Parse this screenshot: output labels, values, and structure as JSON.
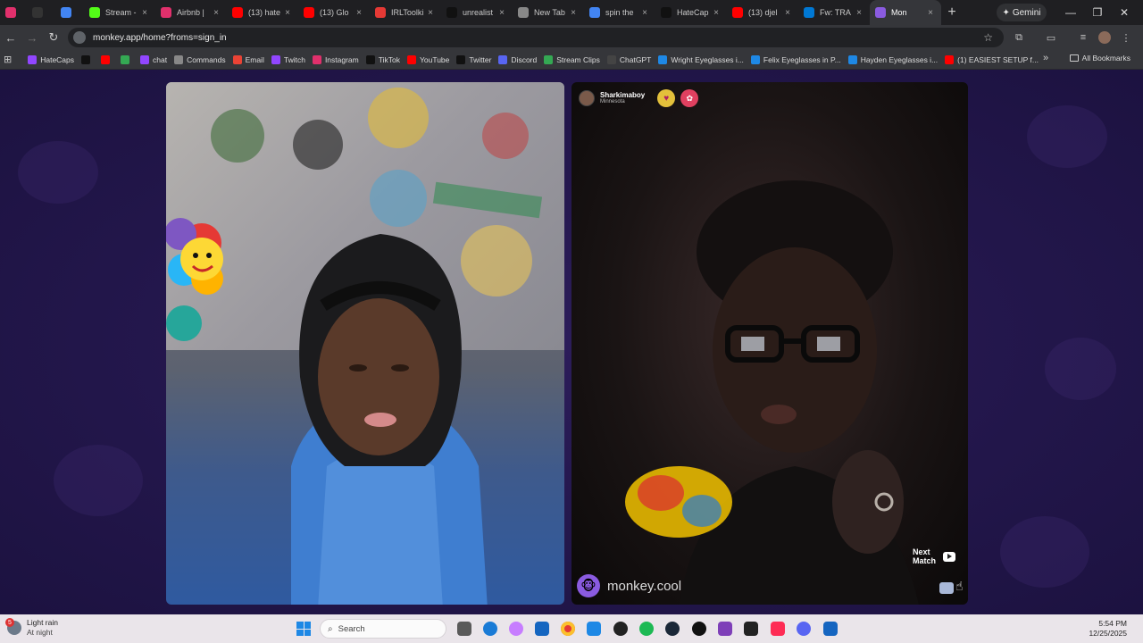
{
  "tabs": [
    {
      "title": "",
      "icon": "instagram-icon",
      "color": "#e1306c"
    },
    {
      "title": "",
      "icon": "threads-icon",
      "color": "#333333"
    },
    {
      "title": "",
      "icon": "docs-icon",
      "color": "#4285f4"
    },
    {
      "title": "Stream -",
      "icon": "kick-icon",
      "color": "#53fc18"
    },
    {
      "title": "Airbnb |",
      "icon": "instagram-icon",
      "color": "#e1306c"
    },
    {
      "title": "(13) hate",
      "icon": "youtube-icon",
      "color": "#ff0000"
    },
    {
      "title": "(13) Glo",
      "icon": "youtube-icon",
      "color": "#ff0000"
    },
    {
      "title": "IRLToolki",
      "icon": "irl-icon",
      "color": "#e53935"
    },
    {
      "title": "unrealist",
      "icon": "tiktok-icon",
      "color": "#111111"
    },
    {
      "title": "New Tab",
      "icon": "chrome-icon",
      "color": "#888888"
    },
    {
      "title": "spin the",
      "icon": "google-icon",
      "color": "#4285f4"
    },
    {
      "title": "HateCap",
      "icon": "x-icon",
      "color": "#111111"
    },
    {
      "title": "(13) djel",
      "icon": "youtube-icon",
      "color": "#ff0000"
    },
    {
      "title": "Fw: TRA",
      "icon": "outlook-icon",
      "color": "#0078d4"
    },
    {
      "title": "Mon",
      "icon": "monkey-icon",
      "color": "#8a5be0",
      "active": true
    }
  ],
  "gemini_label": "Gemini",
  "url": "monkey.app/home?froms=sign_in",
  "bookmarks": [
    {
      "label": "HateCaps",
      "icon": "twitch-icon",
      "color": "#9146ff"
    },
    {
      "label": "",
      "icon": "x-icon",
      "color": "#111111"
    },
    {
      "label": "",
      "icon": "youtube-icon",
      "color": "#ff0000"
    },
    {
      "label": "",
      "icon": "maps-icon",
      "color": "#34a853"
    },
    {
      "label": "chat",
      "icon": "twitch-icon",
      "color": "#9146ff"
    },
    {
      "label": "Commands",
      "icon": "commands-icon",
      "color": "#888888"
    },
    {
      "label": "Email",
      "icon": "gmail-icon",
      "color": "#ea4335"
    },
    {
      "label": "Twitch",
      "icon": "twitch-icon",
      "color": "#9146ff"
    },
    {
      "label": "Instagram",
      "icon": "instagram-icon",
      "color": "#e1306c"
    },
    {
      "label": "TikTok",
      "icon": "tiktok-icon",
      "color": "#111111"
    },
    {
      "label": "YouTube",
      "icon": "youtube-icon",
      "color": "#ff0000"
    },
    {
      "label": "Twitter",
      "icon": "x-icon",
      "color": "#111111"
    },
    {
      "label": "Discord",
      "icon": "discord-icon",
      "color": "#5865f2"
    },
    {
      "label": "Stream Clips",
      "icon": "drive-icon",
      "color": "#34a853"
    },
    {
      "label": "ChatGPT",
      "icon": "chatgpt-icon",
      "color": "#444444"
    },
    {
      "label": "Wright Eyeglasses i...",
      "icon": "wp-icon",
      "color": "#1e88e5"
    },
    {
      "label": "Felix Eyeglasses in P...",
      "icon": "wp-icon",
      "color": "#1e88e5"
    },
    {
      "label": "Hayden Eyeglasses i...",
      "icon": "wp-icon",
      "color": "#1e88e5"
    },
    {
      "label": "(1) EASIEST SETUP f...",
      "icon": "youtube-icon",
      "color": "#ff0000"
    }
  ],
  "all_bookmarks": "All Bookmarks",
  "remote_user": {
    "name": "Sharkimaboy",
    "location": "Minnesota"
  },
  "next_match": {
    "line1": "Next",
    "line2": "Match"
  },
  "brand": "monkey.cool",
  "taskbar": {
    "weather_main": "Light rain",
    "weather_sub": "At night",
    "weather_badge": "5",
    "search_placeholder": "Search",
    "time": "5:54 PM",
    "date": "12/25/2025"
  }
}
